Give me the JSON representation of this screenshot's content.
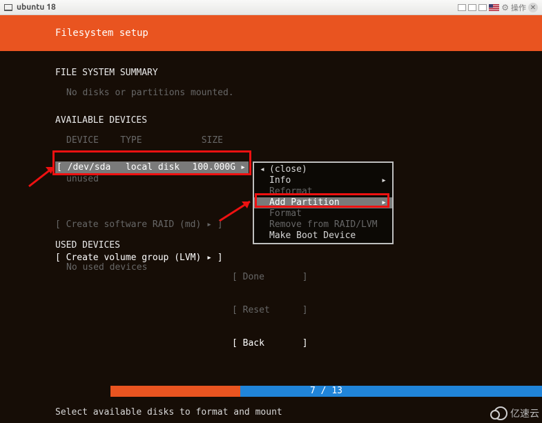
{
  "window": {
    "title": "ubuntu 18",
    "operate_label": "操作"
  },
  "header": {
    "title": "Filesystem setup"
  },
  "summary": {
    "title": "FILE SYSTEM SUMMARY",
    "message": "No disks or partitions mounted."
  },
  "available": {
    "title": "AVAILABLE DEVICES",
    "columns": {
      "device": "DEVICE",
      "type": "TYPE",
      "size": "SIZE"
    },
    "disk": {
      "device": "/dev/sda",
      "type": "local disk",
      "size": "100.000G"
    },
    "unused": "unused",
    "raid_label": "Create software RAID (md)",
    "lvm_label": "Create volume group (LVM)"
  },
  "menu": {
    "close": "(close)",
    "info": "Info",
    "reformat": "Reformat",
    "add_partition": "Add Partition",
    "format": "Format",
    "remove": "Remove from RAID/LVM",
    "make_boot": "Make Boot Device"
  },
  "used": {
    "title": "USED DEVICES",
    "message": "No used devices"
  },
  "buttons": {
    "done": "Done",
    "reset": "Reset",
    "back": "Back"
  },
  "progress": {
    "current": 7,
    "total": 13,
    "label": "7 / 13"
  },
  "hint": "Select available disks to format and mount",
  "watermark": "亿速云"
}
